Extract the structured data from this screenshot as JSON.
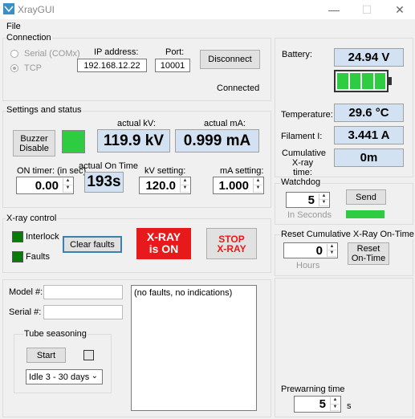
{
  "window": {
    "title": "XrayGUI",
    "minimize": "—",
    "maximize": "☐",
    "close": "✕"
  },
  "menu": {
    "file": "File"
  },
  "connection": {
    "group": "Connection",
    "serial": "Serial (COMx)",
    "tcp": "TCP",
    "ip_label": "IP address:",
    "ip_value": "192.168.12.22",
    "port_label": "Port:",
    "port_value": "10001",
    "disconnect": "Disconnect",
    "status": "Connected"
  },
  "settings": {
    "group": "Settings and status",
    "buzzer": "Buzzer Disable",
    "actual_kv_label": "actual kV:",
    "actual_kv": "119.9 kV",
    "actual_ma_label": "actual mA:",
    "actual_ma": "0.999 mA",
    "on_timer_label": "ON timer: (in sec)",
    "on_timer": "0.00",
    "actual_on_label": "actual On Time",
    "actual_on": "193s",
    "kv_setting_label": "kV setting:",
    "kv_setting": "120.0",
    "ma_setting_label": "mA setting:",
    "ma_setting": "1.000"
  },
  "xray": {
    "group": "X-ray control",
    "interlock": "Interlock",
    "faults": "Faults",
    "clear_faults": "Clear faults",
    "xray_on_line1": "X-RAY",
    "xray_on_line2": "is ON",
    "stop_line1": "STOP",
    "stop_line2": "X-RAY"
  },
  "bottom": {
    "model_label": "Model #:",
    "serial_label": "Serial #:",
    "seasoning_group": "Tube seasoning",
    "start": "Start",
    "idle": "Idle 3 - 30 days",
    "faults_text": "(no faults, no indications)"
  },
  "right": {
    "battery_label": "Battery:",
    "battery": "24.94 V",
    "battery_level": 1.0,
    "temperature_label": "Temperature:",
    "temperature": "29.6 °C",
    "filament_label": "Filament I:",
    "filament": "3.441 A",
    "cumulative_label": "Cumulative X-ray time:",
    "cumulative": "0m",
    "watchdog_group": "Watchdog",
    "watchdog_value": "5",
    "send": "Send",
    "in_seconds": "In Seconds",
    "reset_group": "Reset Cumulative X-Ray On-Time",
    "reset_value": "0",
    "hours": "Hours",
    "reset_btn": "Reset On-Time",
    "prewarm_label": "Prewarning time",
    "prewarm_value": "5",
    "prewarm_unit": "s"
  },
  "colors": {
    "accent": "#3c7fb1",
    "led_green": "#2ecc40",
    "xray_on": "#e8191b",
    "display_bg": "#d2e2f2"
  }
}
